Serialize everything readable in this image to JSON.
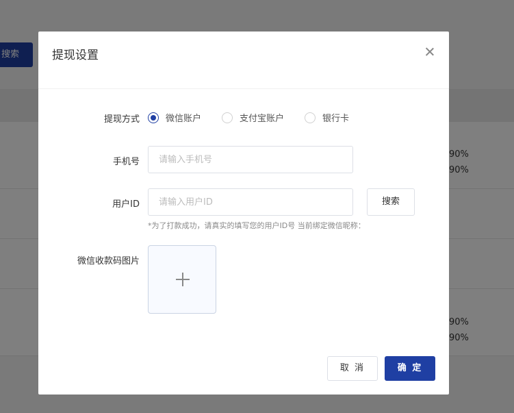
{
  "background": {
    "search_button_label": "搜索",
    "percent_values": [
      "90%",
      "90%",
      "90%",
      "90%"
    ]
  },
  "modal": {
    "title": "提现设置",
    "withdraw_method": {
      "label": "提现方式",
      "options": [
        {
          "label": "微信账户",
          "checked": true
        },
        {
          "label": "支付宝账户",
          "checked": false
        },
        {
          "label": "银行卡",
          "checked": false
        }
      ]
    },
    "phone": {
      "label": "手机号",
      "value": "",
      "placeholder": "请输入手机号"
    },
    "user_id": {
      "label": "用户ID",
      "value": "",
      "placeholder": "请输入用户ID",
      "search_label": "搜索",
      "hint": "*为了打款成功，请真实的填写您的用户ID号 当前绑定微信昵称："
    },
    "qr_upload": {
      "label": "微信收款码图片"
    },
    "footer": {
      "cancel_label": "取 消",
      "confirm_label": "确 定"
    }
  },
  "colors": {
    "primary": "#1f3fa3",
    "overlay": "rgba(0,0,0,0.5)"
  }
}
